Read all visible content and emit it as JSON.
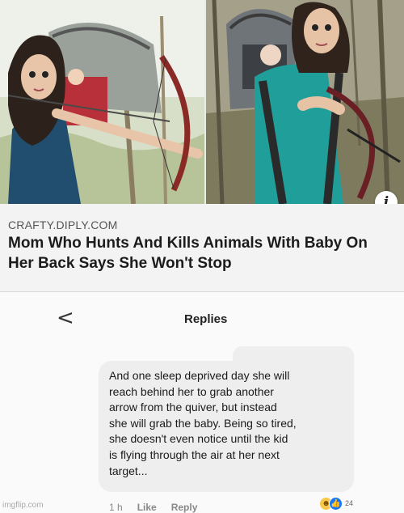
{
  "article": {
    "source": "CRAFTY.DIPLY.COM",
    "headline": "Mom Who Hunts And Kills Animals With Baby On Her Back Says She Won't Stop"
  },
  "info_icon": "info-icon",
  "replies": {
    "title": "Replies",
    "back_icon": "chevron-left-icon",
    "back_glyph": "<"
  },
  "comment": {
    "text": "And one sleep deprived day she will\nreach behind her to grab another\narrow from the quiver, but instead\nshe will grab the baby. Being so tired,\nshe doesn't even notice until the kid\nis flying through the air at her next\ntarget...",
    "time": "1 h",
    "like_label": "Like",
    "reply_label": "Reply",
    "reaction_count": "24",
    "reaction_icons": [
      "laughing-emoji-icon",
      "thumbs-up-icon"
    ]
  },
  "watermark": "imgflip.com",
  "colors": {
    "like_blue": "#1877f2",
    "bubble": "#eeeeee",
    "shirt": "#1f9e9a"
  }
}
